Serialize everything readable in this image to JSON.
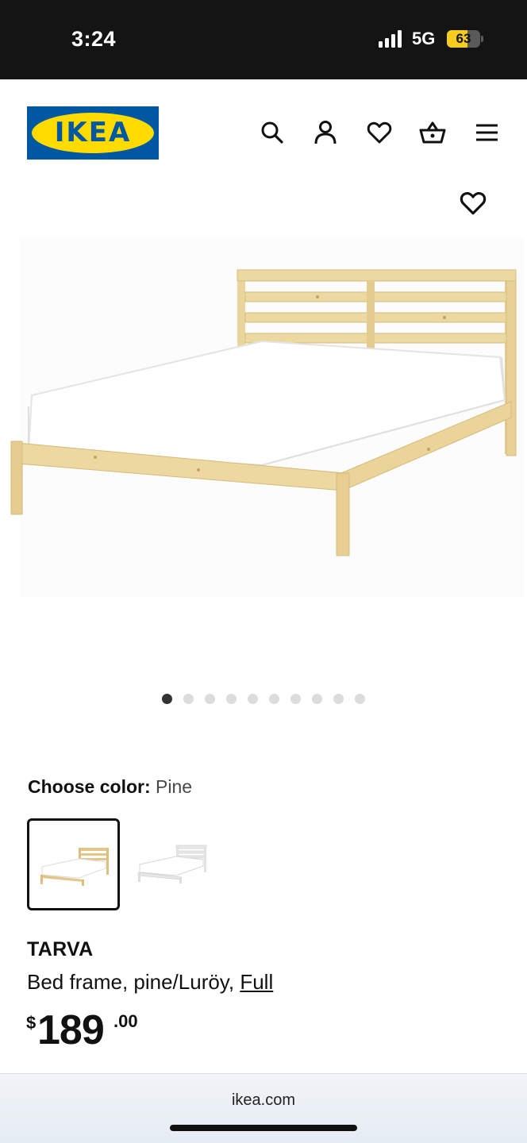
{
  "status_bar": {
    "time": "3:24",
    "network": "5G",
    "battery_level": "63",
    "battery_fraction": 0.63
  },
  "header": {
    "logo_text": "IKEA",
    "icons": [
      "search-icon",
      "account-icon",
      "heart-icon",
      "basket-icon",
      "menu-icon"
    ]
  },
  "gallery": {
    "image_count": 10,
    "active_index": 0
  },
  "color_chooser": {
    "label": "Choose color:",
    "selected": "Pine",
    "options": [
      "Pine",
      "White"
    ]
  },
  "product": {
    "name": "TARVA",
    "description": "Bed frame, pine/Luröy,",
    "size": "Full",
    "price_currency": "$",
    "price_integer": "189",
    "price_decimal": ".00"
  },
  "browser": {
    "url": "ikea.com"
  },
  "colors": {
    "ikea_blue": "#0058a3",
    "ikea_yellow": "#ffdb00",
    "battery_yellow": "#f4cd1f",
    "pine_wood": "#ecd9a2"
  }
}
